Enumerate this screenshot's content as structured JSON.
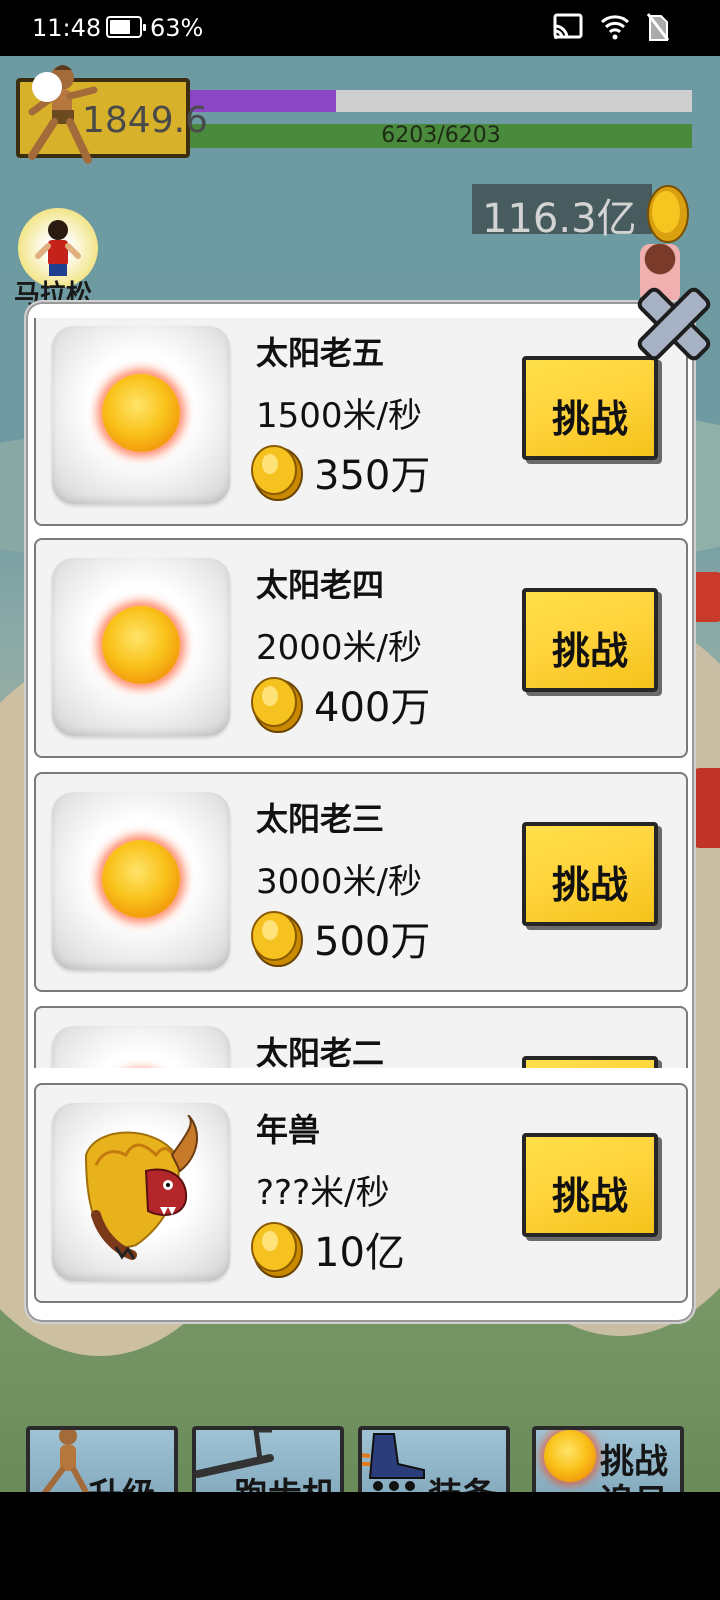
{
  "status_bar": {
    "time": "11:48",
    "battery_percent": "63%",
    "battery_level": 0.63
  },
  "hud": {
    "level_value": "1849.6",
    "exp_progress": 0.29,
    "hp_text": "6203/6203",
    "hp_progress": 1.0,
    "coins": "116.3亿",
    "marathon_label": "马拉松"
  },
  "modal": {
    "items": [
      {
        "name": "太阳老五",
        "speed": "1500米/秒",
        "price": "350万",
        "button": "挑战",
        "icon": "sun-icon"
      },
      {
        "name": "太阳老四",
        "speed": "2000米/秒",
        "price": "400万",
        "button": "挑战",
        "icon": "sun-icon"
      },
      {
        "name": "太阳老三",
        "speed": "3000米/秒",
        "price": "500万",
        "button": "挑战",
        "icon": "sun-icon"
      },
      {
        "name": "太阳老二",
        "speed": "",
        "price": "",
        "button": "",
        "icon": "sun-icon"
      }
    ],
    "boss": {
      "name": "年兽",
      "speed": "???米/秒",
      "price": "10亿",
      "button": "挑战",
      "icon": "nian-beast-icon"
    }
  },
  "bottom_nav": [
    {
      "label": "升级"
    },
    {
      "label": "跑步机"
    },
    {
      "label": "装备"
    },
    {
      "label": "挑战"
    },
    {
      "label": "追日"
    }
  ],
  "colors": {
    "button_yellow": "#ffd23a",
    "exp_purple": "#8a46c4",
    "hp_green": "#4a8a3c"
  }
}
